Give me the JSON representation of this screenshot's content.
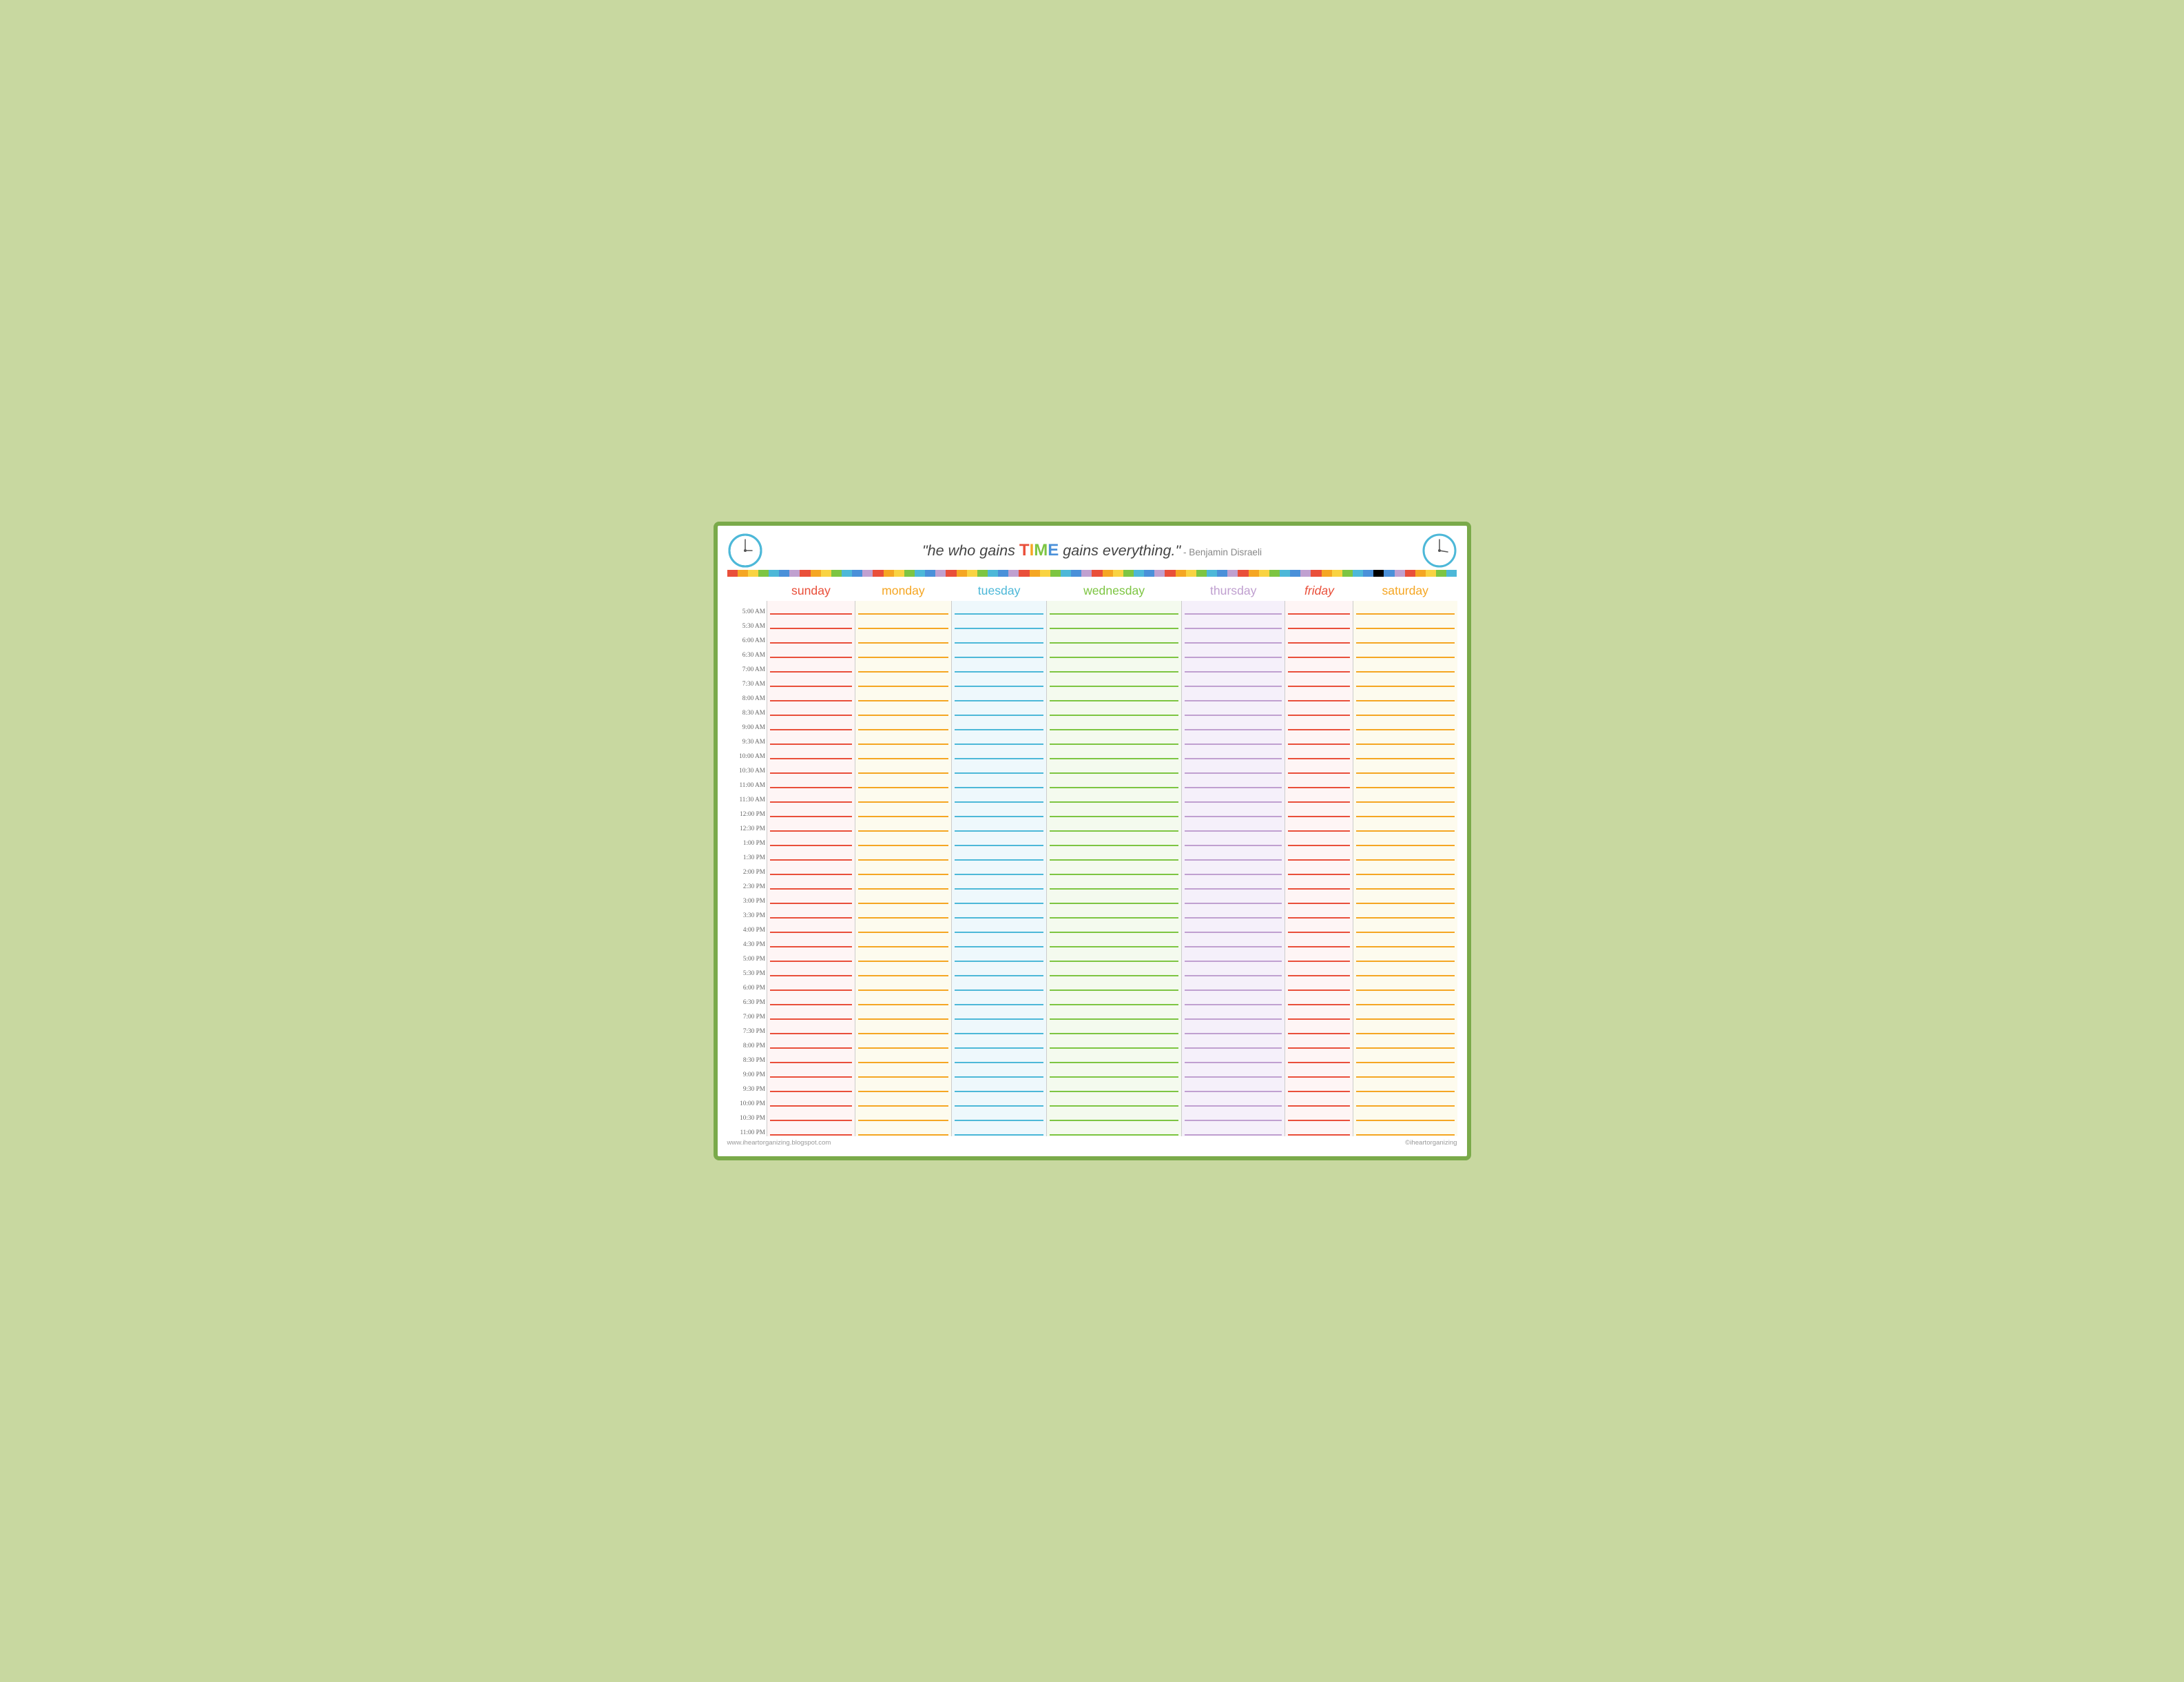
{
  "header": {
    "quote_start": "\"he who gains ",
    "quote_time": "TIME",
    "quote_end": " gains everything.\"",
    "quote_author": " - Benjamin Disraeli"
  },
  "days": {
    "sunday": "sunday",
    "monday": "monday",
    "tuesday": "tuesday",
    "wednesday": "wednesday",
    "thursday": "thursday",
    "friday": "friday",
    "saturday": "saturday"
  },
  "times": [
    "5:00 AM",
    "5:30 AM",
    "6:00 AM",
    "6:30 AM",
    "7:00 AM",
    "7:30 AM",
    "8:00 AM",
    "8:30 AM",
    "9:00 AM",
    "9:30 AM",
    "10:00 AM",
    "10:30 AM",
    "11:00 AM",
    "11:30 AM",
    "12:00 PM",
    "12:30 PM",
    "1:00 PM",
    "1:30 PM",
    "2:00 PM",
    "2:30 PM",
    "3:00 PM",
    "3:30 PM",
    "4:00 PM",
    "4:30 PM",
    "5:00 PM",
    "5:30 PM",
    "6:00 PM",
    "6:30 PM",
    "7:00 PM",
    "7:30 PM",
    "8:00 PM",
    "8:30 PM",
    "9:00 PM",
    "9:30 PM",
    "10:00 PM",
    "10:30 PM",
    "11:00 PM"
  ],
  "rainbow_colors": [
    "#e94f3a",
    "#f5a623",
    "#f9d342",
    "#7dc542",
    "#4db8d8",
    "#4a90d9",
    "#c0a0d0",
    "#e94f3a",
    "#f5a623",
    "#f9d342",
    "#7dc542",
    "#4db8d8",
    "#4a90d9",
    "#c0a0d0",
    "#e94f3a",
    "#f5a623",
    "#f9d342",
    "#7dc542",
    "#4db8d8",
    "#4a90d9",
    "#c0a0d0",
    "#e94f3a",
    "#f5a623",
    "#f9d342",
    "#7dc542",
    "#4db8d8",
    "#4a90d9",
    "#c0a0d0",
    "#e94f3a",
    "#f5a623",
    "#f9d342",
    "#7dc542",
    "#4db8d8",
    "#4a90d9",
    "#c0a0d0",
    "#e94f3a",
    "#f5a623",
    "#f9d342",
    "#7dc542",
    "#4db8d8",
    "#4a90d9",
    "#c0a0d0",
    "#e94f3a",
    "#f5a623",
    "#f9d342",
    "#7dc542",
    "#4db8d8",
    "#4a90d9",
    "#c0a0d0",
    "#e94f3a",
    "#f5a623",
    "#f9d342",
    "#7dc542",
    "#4db8d8",
    "#4a90d9",
    "#c0a0d0",
    "#e94f3a",
    "#f5a623",
    "#f9d342",
    "#7dc542",
    "#4db8d8",
    "#4a90d9",
    "#000000",
    "#4a90d9",
    "#c0a0d0",
    "#e94f3a",
    "#f5a623",
    "#f9d342",
    "#7dc542",
    "#4db8d8"
  ],
  "footer": {
    "left": "www.iheartorganizing.blogspot.com",
    "right": "©iheartorganizing"
  }
}
